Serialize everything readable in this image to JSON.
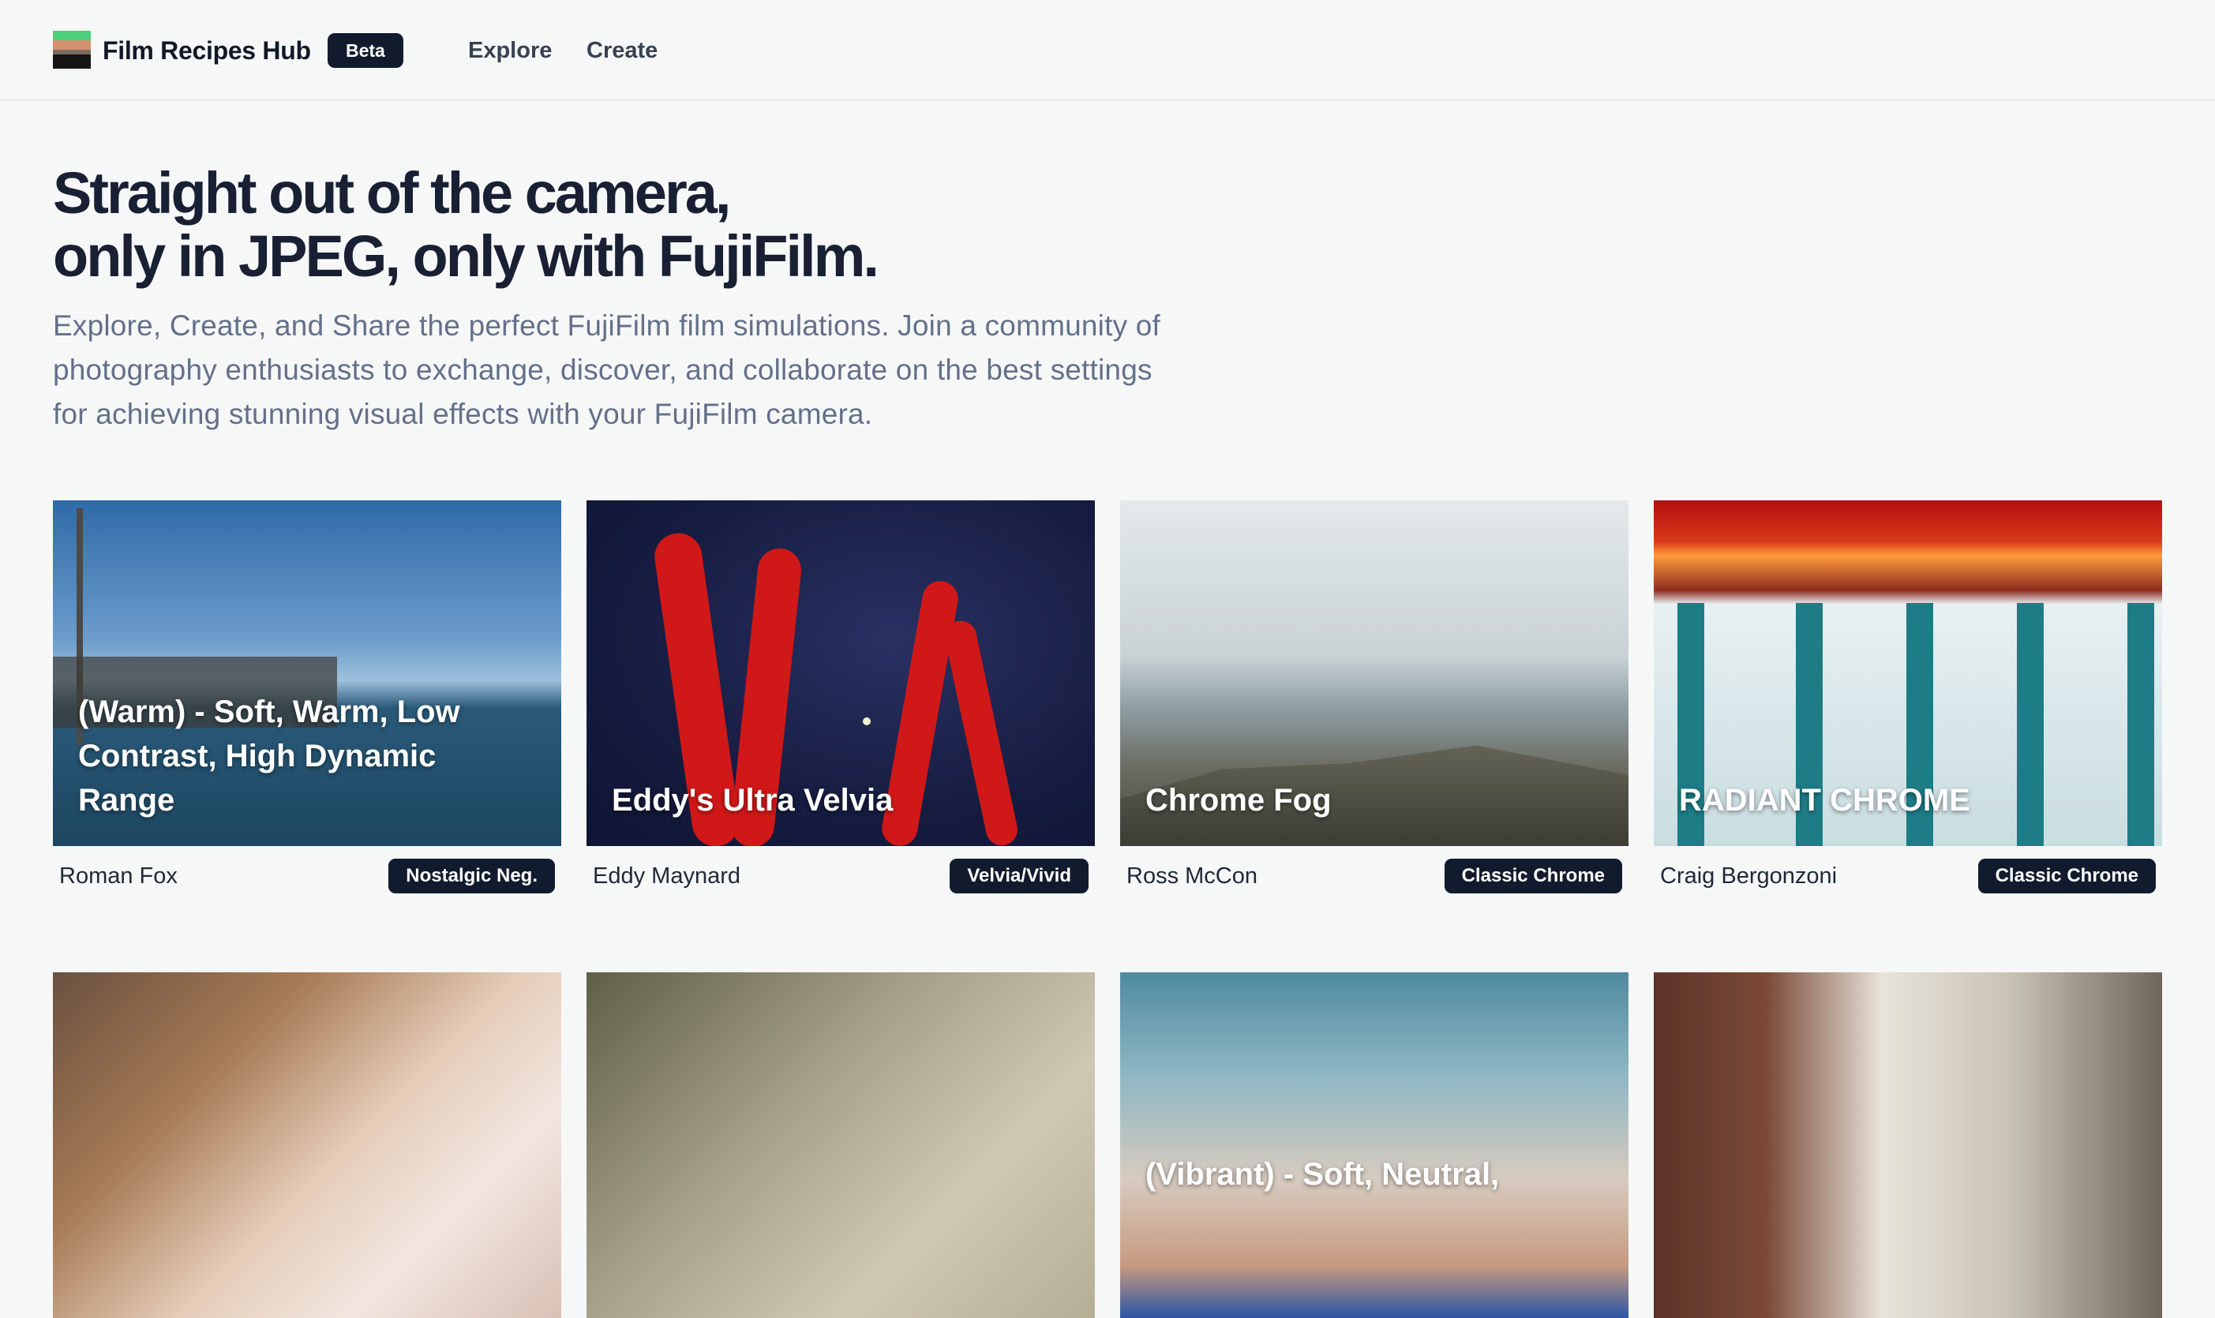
{
  "header": {
    "brand": "Film Recipes Hub",
    "badge": "Beta",
    "nav": [
      "Explore",
      "Create"
    ]
  },
  "hero": {
    "title_line1": "Straight out of the camera,",
    "title_line2": "only in JPEG, only with FujiFilm.",
    "description": "Explore, Create, and Share the perfect FujiFilm film simulations. Join a community of photography enthusiasts to exchange, discover, and collaborate on the best settings for achieving stunning visual effects with your FujiFilm camera."
  },
  "cards": [
    {
      "title": "(Warm) - Soft, Warm, Low Contrast, High Dynamic Range",
      "author": "Roman Fox",
      "simulation": "Nostalgic Neg."
    },
    {
      "title": "Eddy's Ultra Velvia",
      "author": "Eddy Maynard",
      "simulation": "Velvia/Vivid"
    },
    {
      "title": "Chrome Fog",
      "author": "Ross McCon",
      "simulation": "Classic Chrome"
    },
    {
      "title": "RADIANT CHROME",
      "author": "Craig Bergonzoni",
      "simulation": "Classic Chrome"
    },
    {
      "title": "",
      "author": "",
      "simulation": ""
    },
    {
      "title": "",
      "author": "",
      "simulation": ""
    },
    {
      "title": "(Vibrant) - Soft, Neutral,",
      "author": "",
      "simulation": ""
    },
    {
      "title": "",
      "author": "",
      "simulation": ""
    }
  ],
  "colors": {
    "background": "#f6f8f8",
    "badge": "#121b2e",
    "heading": "#192033",
    "muted": "#64708a"
  }
}
